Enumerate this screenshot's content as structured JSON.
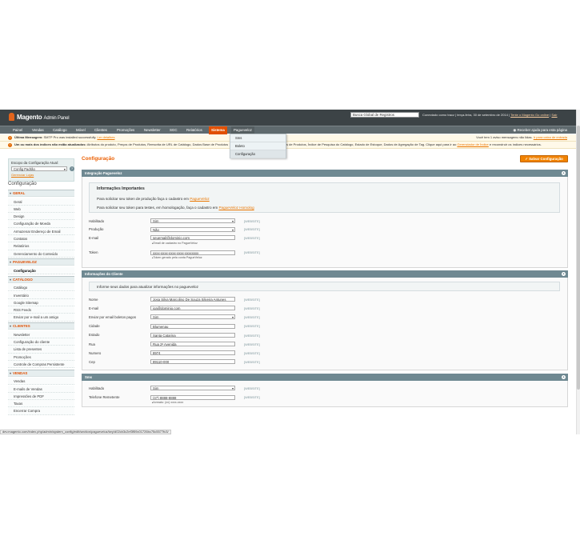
{
  "header": {
    "logo_name": "Magento",
    "logo_suffix": "Admin Panel",
    "search_value": "Busca Global de Registros",
    "user_prefix": "Conectado como tracz",
    "date_text": "terça-feira, 30 de setembro de 2014",
    "tour_link": "Tente o Magento Go online",
    "logout_link": "Sair"
  },
  "nav": {
    "items": [
      "Painel",
      "Vendas",
      "Catálogo",
      "Móvel",
      "Clientes",
      "Promoções",
      "Newsletter",
      "SGC",
      "Relatórios",
      "Sistema",
      "Pagueveloz"
    ],
    "help": "Receber ajuda para esta página"
  },
  "dropdown": {
    "items": [
      "Sms",
      "Boleto",
      "Configuração"
    ]
  },
  "messages": {
    "latest_label": "Última Mensagem:",
    "latest_text": "SMTP Pro was installed successfully.",
    "latest_link": "Ler detalhes",
    "unread_text": "Você tem 1 aviso mensagens não lidas.",
    "unread_link": "Ir para caixa de entrada",
    "index_label": "Um ou mais dos índices não estão atualizados:",
    "index_text": "Atributos do produto, Preços de Produtos, Reescrita de URL de Catálogo, Dados Base de Produtos",
    "index_text2": "s de Produtos, Índice de Pesquisa do Catálogo, Estado de Estoque, Dados de Agregação de Tag. Clique aqui para ir ao",
    "index_link": "Gerenciador de Índice",
    "index_tail": "e reconstruir os índices necessários."
  },
  "sidebar": {
    "scope_title": "Escopo da Configuração Atual:",
    "scope_value": "Config Padrão",
    "scope_link": "Gerenciar Lojas",
    "config_title": "Configuração",
    "sections": [
      {
        "label": "GERAL",
        "items": [
          "Geral",
          "Web",
          "Design",
          "Configuração de Moeda",
          "Armazenar Endereço de Email",
          "Contatos",
          "Relatórios",
          "Gerenciamento do Conteúdo"
        ]
      },
      {
        "label": "PAGUEVELOZ",
        "items": [
          "Configuração"
        ]
      },
      {
        "label": "CATÁLOGO",
        "items": [
          "Catálogo",
          "Inventário",
          "Google Sitemap",
          "RSS Feeds",
          "Enviar por e-mail a um amigo"
        ]
      },
      {
        "label": "CLIENTES",
        "items": [
          "Newsletter",
          "Configuração do cliente",
          "Lista de presentes",
          "Promoções",
          "Controle de Compras Persistente"
        ]
      },
      {
        "label": "VENDAS",
        "items": [
          "Vendas",
          "E-mails de Vendas",
          "Impressões de PDF",
          "Taxas",
          "Encerrar Compra"
        ]
      }
    ]
  },
  "main": {
    "title": "Configuração",
    "save_button": "Salvar Configuração",
    "website_scope": "[WEBSITE]",
    "integracao": {
      "title": "Integração Pagueveloz",
      "info_title": "Informações Importantes",
      "info_line1": "Para solicitar seu token de produção faça o cadastro em",
      "info_link1": "PagueVeloz",
      "info_line2": "Para solicitar seu token para testes, em homologação, faça o cadastro em",
      "info_link2": "PagueVeloz Homolog",
      "fields": [
        {
          "label": "Habilitado",
          "value": "Sim",
          "select": true,
          "note": ""
        },
        {
          "label": "Produção",
          "value": "Não",
          "select": true,
          "note": ""
        },
        {
          "label": "E-mail",
          "value": "seuemail@dominio.com",
          "select": false,
          "note": "Email de cadastro no PagueVeloz"
        },
        {
          "label": "Token",
          "value": "xxxx-xxxx-xxxx-xxxx-xxxxxxxx",
          "select": false,
          "note": "Token gerado pela conta PagueVeloz"
        }
      ]
    },
    "cliente": {
      "title": "Informações do Cliente",
      "info_line": "Informe seus dados para atualizar informações no pagueveloz",
      "fields": [
        {
          "label": "Nome",
          "value": "Josa Silva Marcolino De Souza Silveira Antunes",
          "select": false
        },
        {
          "label": "E-mail",
          "value": "joa@dominio.com",
          "select": false
        },
        {
          "label": "Enviar por email boletos pagos",
          "value": "Sim",
          "select": true
        },
        {
          "label": "Cidade",
          "value": "Blumenau",
          "select": false
        },
        {
          "label": "Estado",
          "value": "Santa Catarina",
          "select": false
        },
        {
          "label": "Rua",
          "value": "Rua 2ª Avenida",
          "select": false
        },
        {
          "label": "Numero",
          "value": "8974",
          "select": false
        },
        {
          "label": "Cep",
          "value": "89110-000",
          "select": false
        }
      ]
    },
    "sms": {
      "title": "Sms",
      "fields": [
        {
          "label": "Habilitado",
          "value": "Sim",
          "select": true,
          "note": ""
        },
        {
          "label": "Telefone Remetente",
          "value": "(47) 8888-8888",
          "select": false,
          "note": "formato: (xx) xxxx-xxxx"
        }
      ]
    }
  },
  "status_url": "dev.magento.com/index.php/admin/system_config/edit/section/pagueveloz/key/d02cb3c2ef3f59c01726bc75c5577fc3/"
}
